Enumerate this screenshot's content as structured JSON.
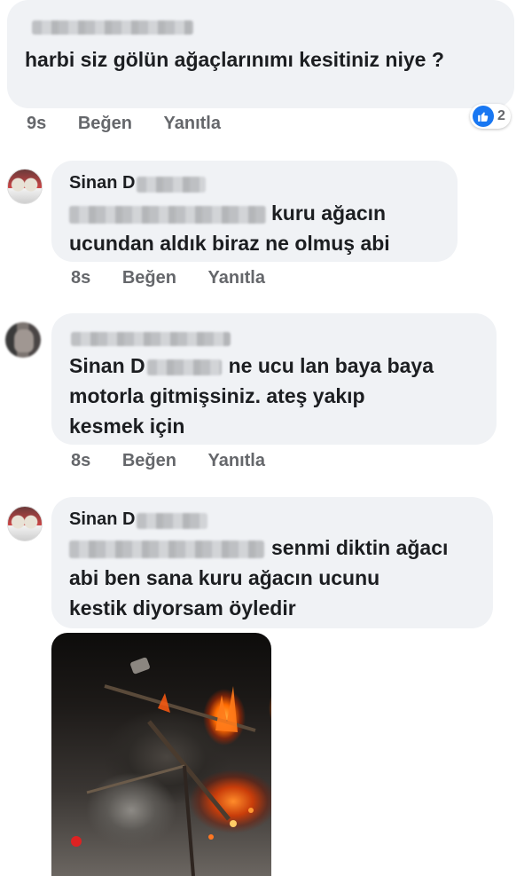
{
  "comments": [
    {
      "text": "harbi siz gölün ağaçlarınımı  kesitiniz niye ?",
      "time": "9s",
      "like_label": "Beğen",
      "reply_label": "Yanıtla",
      "reaction_count": "2"
    },
    {
      "author": "Sinan D",
      "text_line1": "kuru ağacın",
      "text_line2": "ucundan aldık biraz ne olmuş abi",
      "time": "8s",
      "like_label": "Beğen",
      "reply_label": "Yanıtla"
    },
    {
      "tag_name": "Sinan D",
      "text_line1": "ne ucu lan baya baya",
      "text_line2": "motorla gitmişsiniz. ateş yakıp",
      "text_line3": "kesmek için",
      "time": "8s",
      "like_label": "Beğen",
      "reply_label": "Yanıtla"
    },
    {
      "author": "Sinan D",
      "text_line1": "senmi diktin ağacı",
      "text_line2": "abi ben sana kuru ağacın ucunu",
      "text_line3": "kestik diyorsam öyledir"
    }
  ],
  "icons": {
    "like": "thumbs-up-icon"
  },
  "colors": {
    "bubble": "#f0f2f5",
    "like_blue": "#1877f2",
    "meta_gray": "#65676b"
  }
}
